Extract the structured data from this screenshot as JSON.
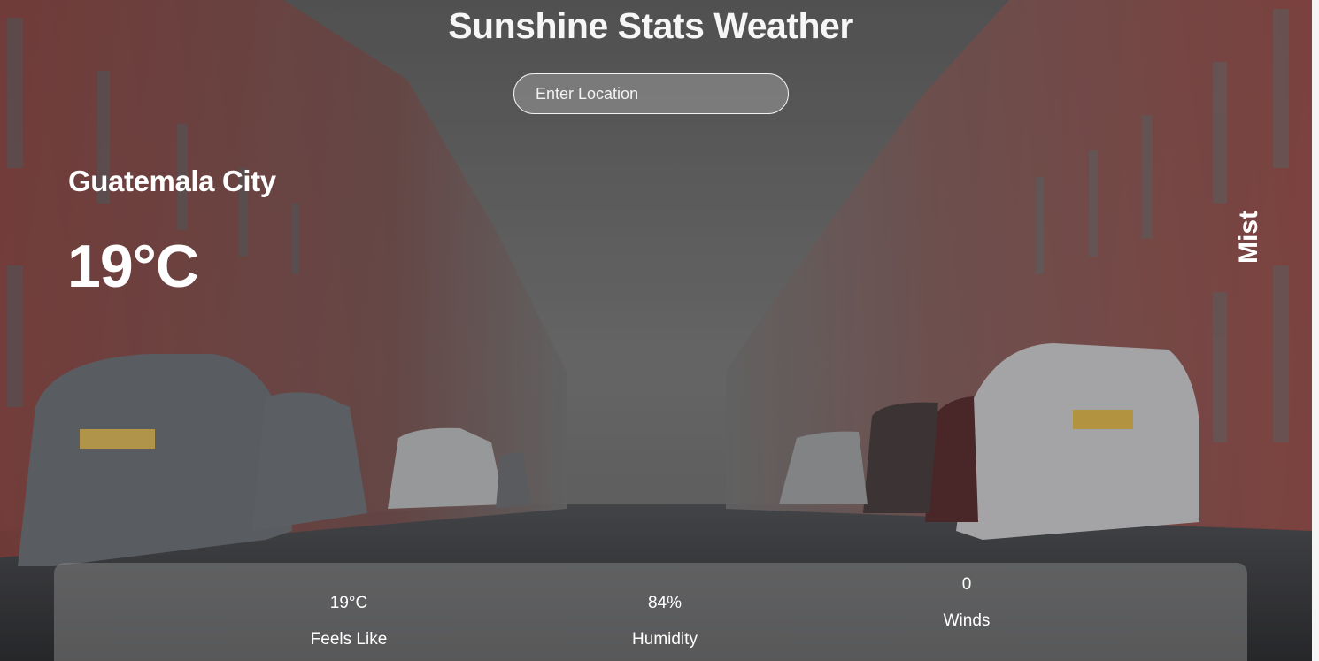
{
  "app": {
    "title": "Sunshine Stats Weather"
  },
  "search": {
    "placeholder": "Enter Location",
    "value": ""
  },
  "weather": {
    "city": "Guatemala City",
    "temperature": "19°C",
    "condition": "Mist"
  },
  "stats": {
    "feels_like": {
      "value": "19°C",
      "label": "Feels Like"
    },
    "humidity": {
      "value": "84%",
      "label": "Humidity"
    },
    "winds": {
      "value": "0",
      "label": "Winds"
    }
  },
  "colors": {
    "text": "#ffffff",
    "panel": "#828282",
    "building": "#9a4a47",
    "fog": "#7a7a7a",
    "road": "#3a3b3e"
  }
}
